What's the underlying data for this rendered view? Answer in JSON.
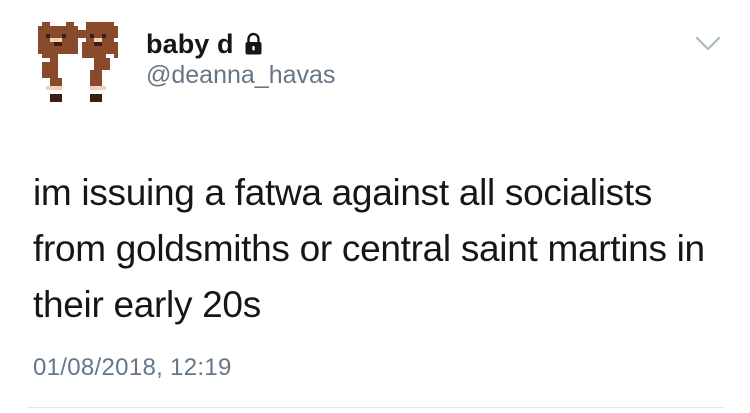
{
  "tweet": {
    "display_name": "baby d",
    "handle": "@deanna_havas",
    "text": "im issuing a fatwa against all socialists from goldsmiths or central saint martins in their early 20s",
    "timestamp": "01/08/2018, 12:19",
    "protected": true
  },
  "icons": {
    "avatar": "dog-costume-pixel-avatar",
    "lock": "lock-icon",
    "menu": "chevron-down-icon"
  },
  "colors": {
    "primary_text": "#14171a",
    "secondary_text": "#657786",
    "divider": "#e1e8ed",
    "avatar_brown": "#8a4a2c",
    "background": "#ffffff"
  }
}
